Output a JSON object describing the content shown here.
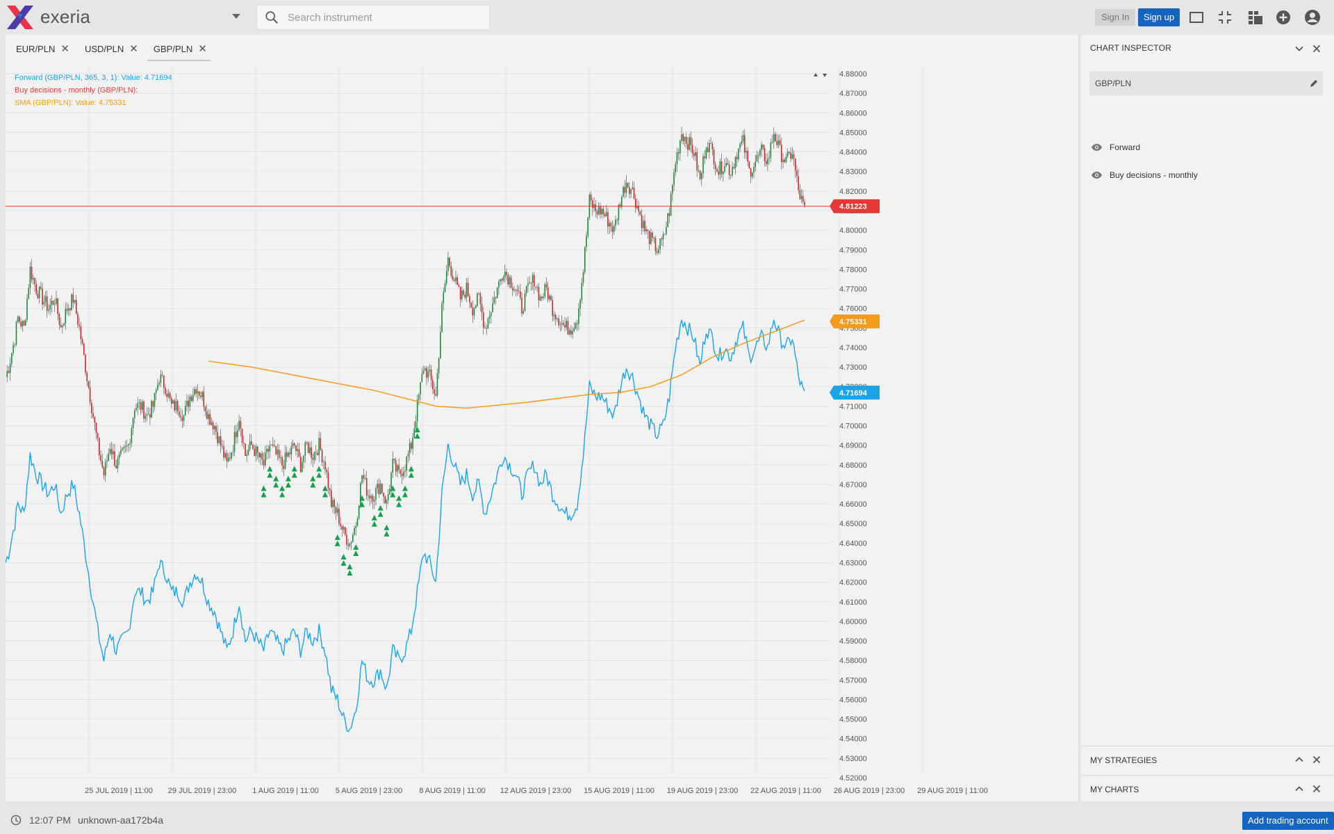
{
  "app": {
    "brand": "exeria",
    "search_placeholder": "Search instrument",
    "sign_in_label": "Sign In",
    "sign_up_label": "Sign up",
    "toolbar_icons": [
      "window-icon",
      "fullscreen-exit-icon",
      "layout-grid-icon",
      "add-circle-icon",
      "account-circle-icon"
    ]
  },
  "tabs": [
    {
      "label": "EUR/PLN",
      "active": false
    },
    {
      "label": "USD/PLN",
      "active": false
    },
    {
      "label": "GBP/PLN",
      "active": true
    }
  ],
  "legend": {
    "forward": "Forward (GBP/PLN, 365, 3, 1): Value: 4.71694",
    "buy": "Buy decisions - monthly (GBP/PLN):",
    "sma": "SMA (GBP/PLN): Value: 4.75331"
  },
  "colors": {
    "forward": "#1aa3e8",
    "buy": "#e53935",
    "sma": "#f59a1b",
    "candle_up": "#1b8a3e",
    "candle_down": "#c62828",
    "buy_marker": "#14a04d",
    "price_line": "#e53935"
  },
  "chart_data": {
    "type": "line",
    "instrument": "GBP/PLN",
    "ylim": [
      4.52,
      4.88
    ],
    "y_ticks": [
      "4.88000",
      "4.87000",
      "4.86000",
      "4.85000",
      "4.84000",
      "4.83000",
      "4.82000",
      "4.81000",
      "4.80000",
      "4.79000",
      "4.78000",
      "4.77000",
      "4.76000",
      "4.75000",
      "4.74000",
      "4.73000",
      "4.72000",
      "4.71000",
      "4.70000",
      "4.69000",
      "4.68000",
      "4.67000",
      "4.66000",
      "4.65000",
      "4.64000",
      "4.63000",
      "4.62000",
      "4.61000",
      "4.60000",
      "4.59000",
      "4.58000",
      "4.57000",
      "4.56000",
      "4.55000",
      "4.54000",
      "4.53000",
      "4.52000"
    ],
    "x_ticks": [
      "25 JUL 2019 | 11:00",
      "29 JUL 2019 | 23:00",
      "1 AUG 2019 | 11:00",
      "5 AUG 2019 | 23:00",
      "8 AUG 2019 | 11:00",
      "12 AUG 2019 | 23:00",
      "15 AUG 2019 | 11:00",
      "19 AUG 2019 | 23:00",
      "22 AUG 2019 | 11:00",
      "26 AUG 2019 | 23:00",
      "29 AUG 2019 | 11:00"
    ],
    "price_anchors": [
      [
        0,
        4.725
      ],
      [
        0.5,
        4.73
      ],
      [
        1.5,
        4.745
      ],
      [
        2,
        4.755
      ],
      [
        3,
        4.75
      ],
      [
        4,
        4.78
      ],
      [
        5,
        4.77
      ],
      [
        6,
        4.765
      ],
      [
        7,
        4.76
      ],
      [
        8,
        4.765
      ],
      [
        9,
        4.75
      ],
      [
        10,
        4.76
      ],
      [
        11,
        4.765
      ],
      [
        12,
        4.75
      ],
      [
        14,
        4.71
      ],
      [
        15,
        4.69
      ],
      [
        16,
        4.675
      ],
      [
        17,
        4.69
      ],
      [
        18,
        4.68
      ],
      [
        19,
        4.685
      ],
      [
        20,
        4.69
      ],
      [
        21,
        4.71
      ],
      [
        22,
        4.71
      ],
      [
        23,
        4.705
      ],
      [
        24,
        4.71
      ],
      [
        25,
        4.725
      ],
      [
        26,
        4.72
      ],
      [
        27,
        4.71
      ],
      [
        28,
        4.71
      ],
      [
        29,
        4.705
      ],
      [
        30,
        4.715
      ],
      [
        31,
        4.72
      ],
      [
        32,
        4.715
      ],
      [
        33,
        4.705
      ],
      [
        34,
        4.7
      ],
      [
        35,
        4.69
      ],
      [
        36,
        4.68
      ],
      [
        37,
        4.69
      ],
      [
        38,
        4.705
      ],
      [
        39,
        4.685
      ],
      [
        40,
        4.69
      ],
      [
        41,
        4.685
      ],
      [
        42,
        4.68
      ],
      [
        43,
        4.69
      ],
      [
        44,
        4.685
      ],
      [
        45,
        4.68
      ],
      [
        46,
        4.685
      ],
      [
        47,
        4.69
      ],
      [
        48,
        4.68
      ],
      [
        49,
        4.69
      ],
      [
        50,
        4.685
      ],
      [
        51,
        4.69
      ],
      [
        52,
        4.68
      ],
      [
        53,
        4.66
      ],
      [
        54,
        4.655
      ],
      [
        55,
        4.645
      ],
      [
        56,
        4.64
      ],
      [
        57,
        4.65
      ],
      [
        58,
        4.675
      ],
      [
        59,
        4.665
      ],
      [
        60,
        4.665
      ],
      [
        61,
        4.67
      ],
      [
        62,
        4.66
      ],
      [
        63,
        4.68
      ],
      [
        64,
        4.675
      ],
      [
        65,
        4.68
      ],
      [
        66,
        4.69
      ],
      [
        67,
        4.71
      ],
      [
        68,
        4.73
      ],
      [
        69,
        4.725
      ],
      [
        70,
        4.715
      ],
      [
        71,
        4.76
      ],
      [
        72,
        4.785
      ],
      [
        73,
        4.775
      ],
      [
        74,
        4.765
      ],
      [
        75,
        4.77
      ],
      [
        76,
        4.76
      ],
      [
        77,
        4.765
      ],
      [
        78,
        4.75
      ],
      [
        79,
        4.76
      ],
      [
        80,
        4.77
      ],
      [
        81,
        4.78
      ],
      [
        82,
        4.775
      ],
      [
        83,
        4.77
      ],
      [
        84,
        4.76
      ],
      [
        85,
        4.77
      ],
      [
        86,
        4.775
      ],
      [
        87,
        4.765
      ],
      [
        88,
        4.77
      ],
      [
        89,
        4.76
      ],
      [
        90,
        4.755
      ],
      [
        91,
        4.75
      ],
      [
        92,
        4.75
      ],
      [
        93,
        4.755
      ],
      [
        94,
        4.78
      ],
      [
        95,
        4.815
      ],
      [
        96,
        4.81
      ],
      [
        97,
        4.81
      ],
      [
        98,
        4.805
      ],
      [
        99,
        4.8
      ],
      [
        100,
        4.815
      ],
      [
        101,
        4.825
      ],
      [
        102,
        4.82
      ],
      [
        103,
        4.81
      ],
      [
        104,
        4.8
      ],
      [
        105,
        4.795
      ],
      [
        106,
        4.79
      ],
      [
        107,
        4.795
      ],
      [
        108,
        4.81
      ],
      [
        109,
        4.835
      ],
      [
        110,
        4.85
      ],
      [
        111,
        4.845
      ],
      [
        112,
        4.84
      ],
      [
        113,
        4.825
      ],
      [
        114,
        4.845
      ],
      [
        115,
        4.84
      ],
      [
        116,
        4.83
      ],
      [
        117,
        4.835
      ],
      [
        118,
        4.83
      ],
      [
        119,
        4.84
      ],
      [
        120,
        4.845
      ],
      [
        121,
        4.83
      ],
      [
        122,
        4.835
      ],
      [
        123,
        4.84
      ],
      [
        124,
        4.835
      ],
      [
        125,
        4.85
      ],
      [
        126,
        4.84
      ],
      [
        127,
        4.835
      ],
      [
        128,
        4.84
      ],
      [
        129,
        4.82
      ],
      [
        130,
        4.81
      ]
    ],
    "x_count": 130,
    "sma_anchors": [
      [
        33,
        4.733
      ],
      [
        40,
        4.73
      ],
      [
        50,
        4.724
      ],
      [
        60,
        4.718
      ],
      [
        70,
        4.71
      ],
      [
        75,
        4.709
      ],
      [
        85,
        4.712
      ],
      [
        95,
        4.716
      ],
      [
        100,
        4.717
      ],
      [
        105,
        4.72
      ],
      [
        110,
        4.726
      ],
      [
        115,
        4.735
      ],
      [
        120,
        4.742
      ],
      [
        125,
        4.748
      ],
      [
        130,
        4.754
      ]
    ],
    "forward_offset": 0.095,
    "buy_marker_x": [
      42,
      43,
      44,
      45,
      46,
      47,
      50,
      51,
      52,
      54,
      55,
      56,
      57,
      58,
      60,
      61,
      62,
      63,
      64,
      65,
      66,
      67
    ],
    "last_price": "4.81223",
    "sma_value": "4.75331",
    "forward_value": "4.71694",
    "current_price_value": 4.81223
  },
  "inspector": {
    "title": "CHART INSPECTOR",
    "instrument": "GBP/PLN",
    "layers": [
      "Forward",
      "Buy decisions - monthly"
    ],
    "sections": [
      "MY STRATEGIES",
      "MY CHARTS"
    ]
  },
  "status": {
    "time": "12:07 PM",
    "user": "unknown-aa172b4a",
    "add_account": "Add trading account"
  }
}
